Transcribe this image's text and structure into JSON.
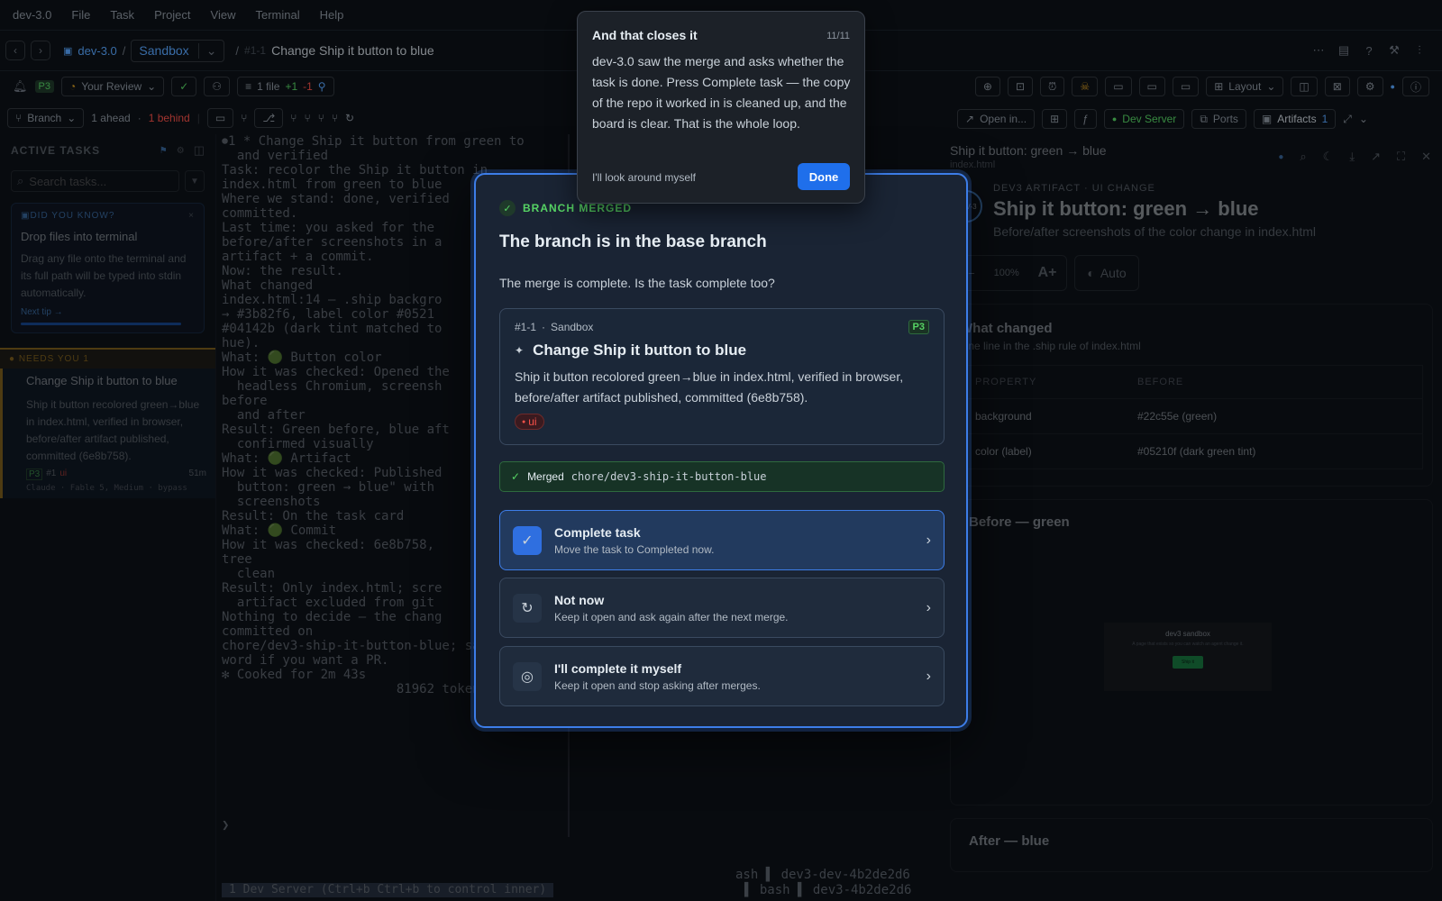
{
  "menubar": {
    "app": "dev-3.0",
    "items": [
      "File",
      "Task",
      "Project",
      "View",
      "Terminal",
      "Help"
    ]
  },
  "header": {
    "project": "dev-3.0",
    "sandbox": "Sandbox",
    "task_id": "#1-1",
    "task_title": "Change Ship it button to blue"
  },
  "toolbar2": {
    "priority": "P3",
    "review": "Your Review",
    "files": "1 file",
    "added": "+1",
    "removed": "-1",
    "layout": "Layout"
  },
  "toolbar3": {
    "branch": "Branch",
    "ahead": "1 ahead",
    "behind": "1 behind"
  },
  "right_toolbar": {
    "open": "Open in...",
    "dev_server": "Dev Server",
    "ports": "Ports",
    "artifacts": "Artifacts",
    "artifacts_count": "1"
  },
  "sidebar": {
    "title": "ACTIVE TASKS",
    "search_placeholder": "Search tasks...",
    "tip_label": "DID YOU KNOW?",
    "tip_title": "Drop files into terminal",
    "tip_body": "Drag any file onto the terminal and its full path will be typed into stdin automatically.",
    "tip_next": "Next tip →",
    "needs_label": "NEEDS YOU",
    "needs_count": "1",
    "card_title": "Change Ship it button to blue",
    "card_body": "Ship it button recolored green→blue in index.html, verified in browser, before/after artifact published, committed (6e8b758).",
    "card_p": "P3",
    "card_id": "#1",
    "card_tag": "ui",
    "card_time": "51m",
    "card_agent": "Claude · Fable 5, Medium · bypass"
  },
  "terminal": {
    "lines": [
      "⏺1 * Change Ship it button from green to",
      "  and verified",
      "Task: recolor the Ship it button in",
      "index.html from green to blue",
      "Where we stand: done, verified",
      "committed.",
      "Last time: you asked for the",
      "before/after screenshots in a",
      "artifact + a commit.",
      "Now: the result.",
      "",
      "What changed",
      "",
      "index.html:14 — .ship backgro",
      "→ #3b82f6, label color #0521",
      "#04142b (dark tint matched to",
      "hue).",
      "",
      "What: 🟢 Button color",
      "How it was checked: Opened the",
      "  headless Chromium, screensh",
      "before",
      "  and after",
      "Result: Green before, blue aft",
      "  confirmed visually",
      "",
      "What: 🟢 Artifact",
      "How it was checked: Published",
      "  button: green → blue\" with",
      "  screenshots",
      "Result: On the task card",
      "",
      "What: 🟢 Commit",
      "How it was checked: 6e8b758, ",
      "tree",
      "  clean",
      "Result: Only index.html; scre",
      "",
      "  artifact excluded from git",
      "",
      "Nothing to decide — the chang",
      "committed on",
      "chore/dev3-ship-it-button-blue; say the",
      "word if you want a PR.",
      "",
      "✻ Cooked for 2m 43s",
      "                       81962 tokens"
    ],
    "prompt": "❯",
    "status_left": "1  Dev Server  (Ctrl+b Ctrl+b to control inner)",
    "status_r1": "ash ▌ dev3-dev-4b2de2d6",
    "status_r2": "▌ bash ▌ dev3-4b2de2d6"
  },
  "artifact": {
    "title": "Ship it button: green → blue",
    "file": "index.html",
    "kicker": "DEV3 ARTIFACT · UI CHANGE",
    "heading": "Ship it button: green → blue",
    "subtitle": "Before/after screenshots of the color change in index.html",
    "zoom": "100%",
    "auto": "Auto",
    "what_changed": "What changed",
    "what_desc": "One line in the .ship rule of index.html",
    "col1": "PROPERTY",
    "col2": "BEFORE",
    "rows": [
      {
        "p": "background",
        "b": "#22c55e (green)"
      },
      {
        "p": "color (label)",
        "b": "#05210f (dark green tint)"
      }
    ],
    "before_title": "Before — green",
    "after_title": "After — blue",
    "mini_title": "dev3 sandbox",
    "mini_desc": "A page that exists so you can watch an agent change it.",
    "mini_btn": "Ship it"
  },
  "modal": {
    "badge": "BRANCH MERGED",
    "title": "The branch is in the base branch",
    "question": "The merge is complete. Is the task complete too?",
    "task_id": "#1-1",
    "task_project": "Sandbox",
    "task_priority": "P3",
    "task_title": "Change Ship it button to blue",
    "task_desc": "Ship it button recolored green→blue in index.html, verified in browser, before/after artifact published, committed (6e8b758).",
    "task_tag": "ui",
    "merged_label": "Merged",
    "merged_branch": "chore/dev3-ship-it-button-blue",
    "options": [
      {
        "title": "Complete task",
        "desc": "Move the task to Completed now."
      },
      {
        "title": "Not now",
        "desc": "Keep it open and ask again after the next merge."
      },
      {
        "title": "I'll complete it myself",
        "desc": "Keep it open and stop asking after merges."
      }
    ]
  },
  "tour": {
    "title": "And that closes it",
    "step": "11/11",
    "body": "dev-3.0 saw the merge and asks whether the task is done. Press Complete task — the copy of the repo it worked in is cleaned up, and the board is clear. That is the whole loop.",
    "skip": "I'll look around myself",
    "done": "Done"
  }
}
